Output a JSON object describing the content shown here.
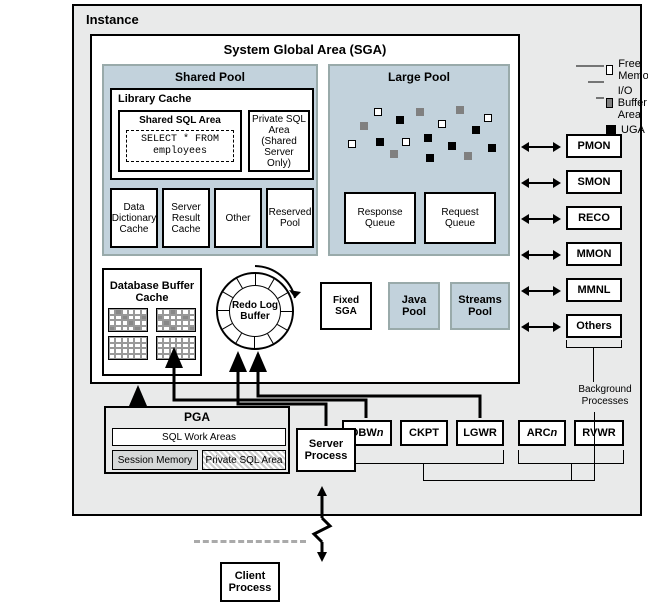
{
  "instance": {
    "label": "Instance"
  },
  "sga": {
    "title": "System Global Area (SGA)"
  },
  "shared_pool": {
    "title": "Shared Pool",
    "library_cache": "Library Cache",
    "shared_sql_area": "Shared SQL Area",
    "sql_stmt": "SELECT * FROM\nemployees",
    "private_sql": "Private SQL Area (Shared Server Only)",
    "data_dict": "Data Dictionary Cache",
    "server_result": "Server Result Cache",
    "other": "Other",
    "reserved": "Reserved Pool"
  },
  "large_pool": {
    "title": "Large Pool",
    "response_q": "Response Queue",
    "request_q": "Request Queue"
  },
  "legend": {
    "free": "Free Memory",
    "io": "I/O Buffer Area",
    "uga": "UGA"
  },
  "sga_row": {
    "db_buffer": "Database Buffer Cache",
    "redo": "Redo Log Buffer",
    "fixed": "Fixed SGA",
    "java": "Java Pool",
    "streams": "Streams Pool"
  },
  "right_procs": {
    "pmon": "PMON",
    "smon": "SMON",
    "reco": "RECO",
    "mmon": "MMON",
    "mmnl": "MMNL",
    "others": "Others",
    "bg_label": "Background Processes"
  },
  "bottom_procs": {
    "dbwn_prefix": "DBW",
    "dbwn_suffix": "n",
    "ckpt": "CKPT",
    "lgwr": "LGWR",
    "arcn_prefix": "ARC",
    "arcn_suffix": "n",
    "rvwr": "RVWR"
  },
  "pga": {
    "title": "PGA",
    "sql_work": "SQL Work Areas",
    "session_mem": "Session Memory",
    "private_sql": "Private SQL Area"
  },
  "server_process": "Server Process",
  "client_process": "Client Process"
}
